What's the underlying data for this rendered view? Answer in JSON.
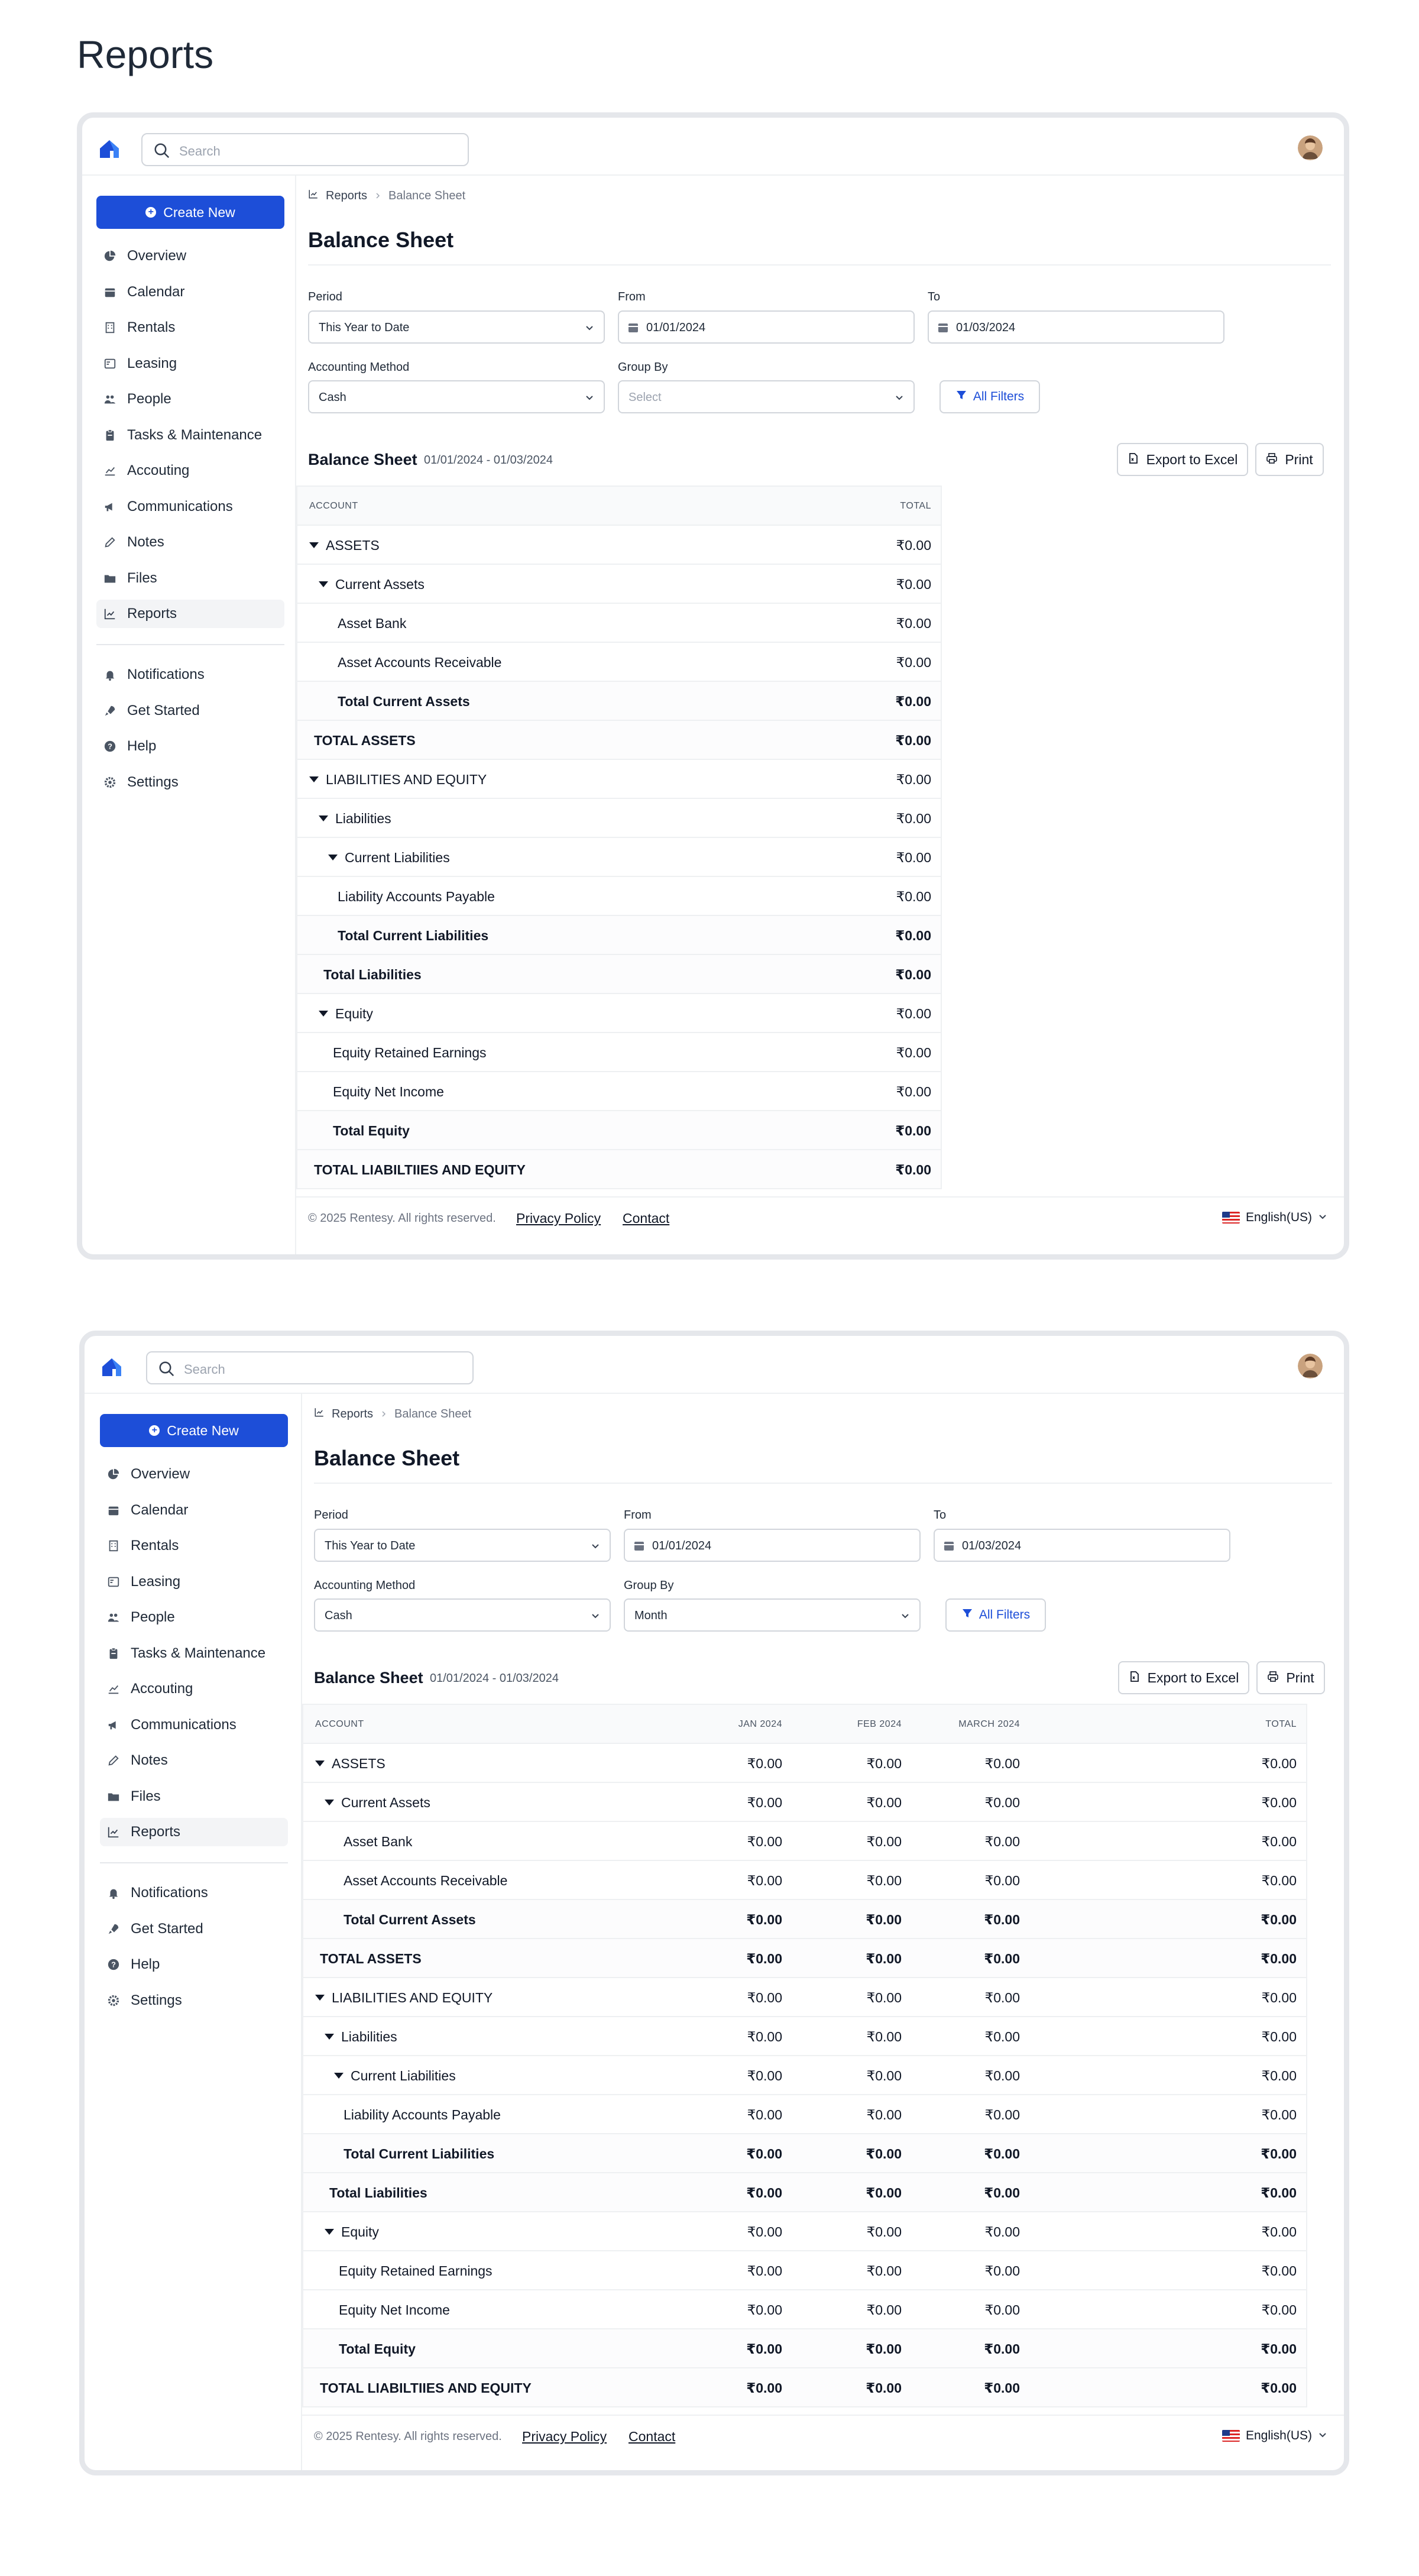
{
  "page_title": "Reports",
  "app": {
    "search_placeholder": "Search",
    "create_new": "Create New",
    "nav": [
      "Overview",
      "Calendar",
      "Rentals",
      "Leasing",
      "People",
      "Tasks & Maintenance",
      "Accouting",
      "Communications",
      "Notes",
      "Files",
      "Reports"
    ],
    "nav_icons": [
      "chart-pie-icon",
      "calendar-icon",
      "building-icon",
      "lease-icon",
      "people-icon",
      "clipboard-icon",
      "accounting-icon",
      "megaphone-icon",
      "pencil-icon",
      "folder-icon",
      "chart-line-icon"
    ],
    "nav_bottom": [
      "Notifications",
      "Get Started",
      "Help",
      "Settings"
    ],
    "nav_bottom_icons": [
      "bell-icon",
      "rocket-icon",
      "help-icon",
      "gear-icon"
    ],
    "breadcrumb": [
      "Reports",
      "Balance Sheet"
    ],
    "heading": "Balance Sheet",
    "labels": {
      "period": "Period",
      "from": "From",
      "to": "To",
      "method": "Accounting Method",
      "group_by": "Group By"
    },
    "all_filters": "All Filters",
    "section_title": "Balance Sheet",
    "section_range": "01/01/2024 - 01/03/2024",
    "export": "Export to Excel",
    "print": "Print",
    "footer": {
      "copyright": "© 2025 Rentesy. All rights reserved.",
      "privacy": "Privacy Policy",
      "contact": "Contact",
      "language": "English(US)"
    }
  },
  "panel1": {
    "period": "This Year to Date",
    "from": "01/01/2024",
    "to": "01/03/2024",
    "method": "Cash",
    "group_by": "Select",
    "columns": [
      "ACCOUNT",
      "TOTAL"
    ],
    "rows": [
      {
        "label": "ASSETS",
        "indent": 0,
        "caret": true,
        "bold": false,
        "total": "₹0.00"
      },
      {
        "label": "Current Assets",
        "indent": 1,
        "caret": true,
        "bold": false,
        "total": "₹0.00"
      },
      {
        "label": "Asset Bank",
        "indent": 3,
        "caret": false,
        "bold": false,
        "total": "₹0.00"
      },
      {
        "label": "Asset Accounts Receivable",
        "indent": 3,
        "caret": false,
        "bold": false,
        "total": "₹0.00"
      },
      {
        "label": "Total Current Assets",
        "indent": 3,
        "caret": false,
        "bold": true,
        "total": "₹0.00"
      },
      {
        "label": "TOTAL ASSETS",
        "indent": 0.5,
        "caret": false,
        "bold": true,
        "total": "₹0.00"
      },
      {
        "label": "LIABILITIES AND EQUITY",
        "indent": 0,
        "caret": true,
        "bold": false,
        "total": "₹0.00"
      },
      {
        "label": "Liabilities",
        "indent": 1,
        "caret": true,
        "bold": false,
        "total": "₹0.00"
      },
      {
        "label": "Current Liabilities",
        "indent": 2,
        "caret": true,
        "bold": false,
        "total": "₹0.00"
      },
      {
        "label": "Liability Accounts Payable",
        "indent": 3,
        "caret": false,
        "bold": false,
        "total": "₹0.00"
      },
      {
        "label": "Total Current Liabilities",
        "indent": 3,
        "caret": false,
        "bold": true,
        "total": "₹0.00"
      },
      {
        "label": "Total Liabilities",
        "indent": 1.5,
        "caret": false,
        "bold": true,
        "total": "₹0.00"
      },
      {
        "label": "Equity",
        "indent": 1,
        "caret": true,
        "bold": false,
        "total": "₹0.00"
      },
      {
        "label": "Equity Retained Earnings",
        "indent": 2.5,
        "caret": false,
        "bold": false,
        "total": "₹0.00"
      },
      {
        "label": "Equity Net Income",
        "indent": 2.5,
        "caret": false,
        "bold": false,
        "total": "₹0.00"
      },
      {
        "label": "Total Equity",
        "indent": 2.5,
        "caret": false,
        "bold": true,
        "total": "₹0.00"
      },
      {
        "label": "TOTAL LIABILTIIES AND EQUITY",
        "indent": 0.5,
        "caret": false,
        "bold": true,
        "total": "₹0.00"
      }
    ]
  },
  "panel2": {
    "period": "This Year to Date",
    "from": "01/01/2024",
    "to": "01/03/2024",
    "method": "Cash",
    "group_by": "Month",
    "columns": [
      "ACCOUNT",
      "JAN 2024",
      "FEB 2024",
      "MARCH 2024",
      "TOTAL"
    ],
    "value": "₹0.00"
  }
}
